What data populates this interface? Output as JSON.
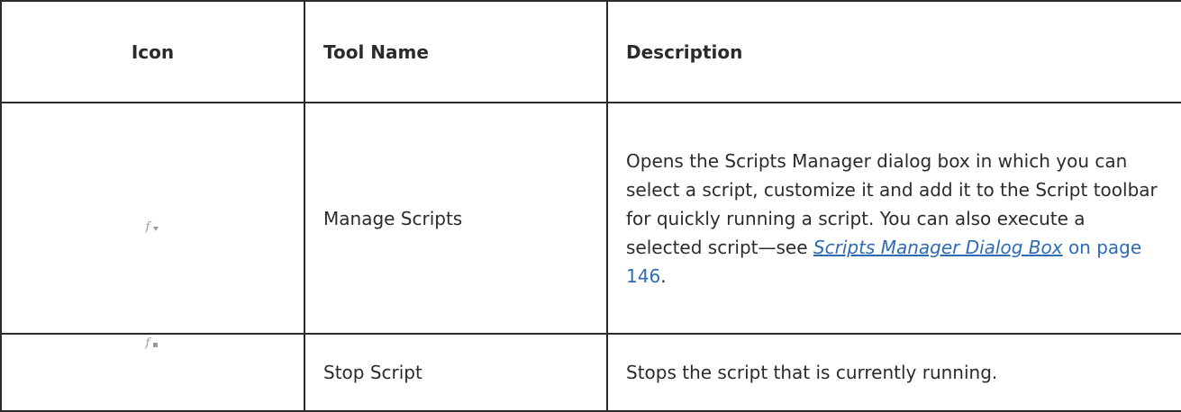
{
  "table": {
    "headers": {
      "icon": "Icon",
      "tool_name": "Tool Name",
      "description": "Description"
    },
    "rows": [
      {
        "icon": "manage-scripts-icon",
        "tool_name": "Manage Scripts",
        "description_prefix": "Opens the Scripts Manager dialog box in which you can select a script, customize it and add it to the Script toolbar for quickly running a script. You can also execute a selected script—see ",
        "link_text": "Scripts Manager Dialog Box",
        "page_text": "on page 146",
        "description_suffix": "."
      },
      {
        "icon": "stop-script-icon",
        "tool_name": "Stop Script",
        "description": "Stops the script that is currently running."
      }
    ]
  },
  "colors": {
    "text": "#2b2b2b",
    "border": "#2b2b2b",
    "link": "#2f6bb3",
    "icon": "#9a9a9a"
  }
}
